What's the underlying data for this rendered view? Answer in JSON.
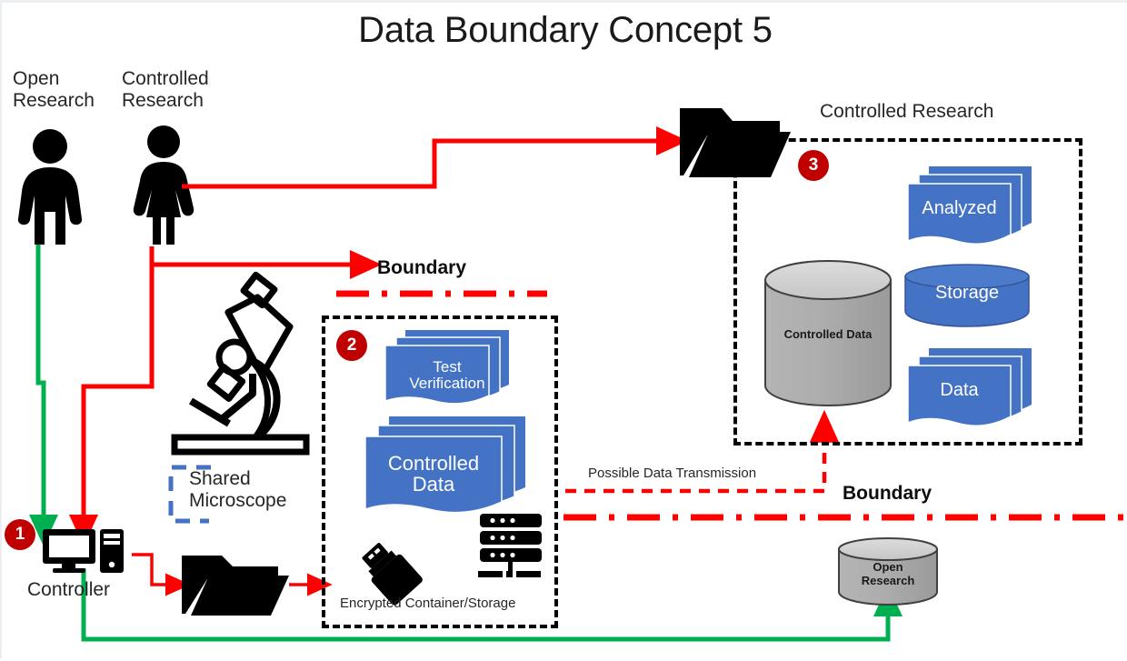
{
  "title": "Data Boundary Concept 5",
  "actors": [
    {
      "name": "open-researcher",
      "label": "Open\nResearch",
      "line1": "Open",
      "line2": "Research"
    },
    {
      "name": "controlled-researcher",
      "label": "Controlled\nResearch",
      "line1": "Controlled",
      "line2": "Research"
    }
  ],
  "labels": {
    "controller": "Controller",
    "shared_microscope_line1": "Shared",
    "shared_microscope_line2": "Microscope",
    "encrypted_container": "Encrypted Container/Storage",
    "boundary_mid": "Boundary",
    "boundary_right": "Boundary",
    "possible_data_transmission": "Possible Data Transmission",
    "controlled_research_zone": "Controlled Research"
  },
  "markers": {
    "one": "1",
    "two": "2",
    "three": "3"
  },
  "mid_zone": {
    "docs": [
      {
        "name": "test-verification-docs",
        "line1": "Test",
        "line2": "Verification"
      },
      {
        "name": "controlled-data-docs",
        "line1": "Controlled",
        "line2": "Data"
      }
    ]
  },
  "right_zone": {
    "cylinder": {
      "line1": "Controlled Data",
      "line2": ""
    },
    "items": [
      {
        "name": "analyzed-docs",
        "type": "docs",
        "label": "Analyzed"
      },
      {
        "name": "storage-cylinder",
        "type": "cylinder",
        "label": "Storage"
      },
      {
        "name": "data-docs",
        "type": "docs",
        "label": "Data"
      }
    ]
  },
  "bottom_zone": {
    "open_research_cylinder": {
      "line1": "Open",
      "line2": "Research"
    }
  },
  "colors": {
    "red": "#FF0000",
    "dark_red": "#C00000",
    "green": "#00B050",
    "blue_doc": "#4472C4",
    "blue_dash": "#4472C4",
    "grey_cylinder": "#A6A6A6",
    "black": "#000000",
    "background": "#FFFFFF"
  }
}
